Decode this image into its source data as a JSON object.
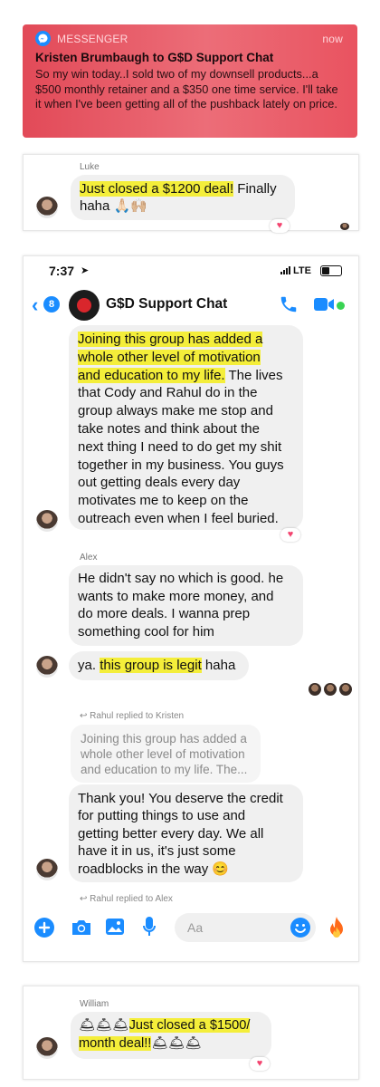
{
  "notification": {
    "app": "MESSENGER",
    "time": "now",
    "title": "Kristen Brumbaugh to G$D Support Chat",
    "body": "So my win today..I sold two of my downsell products...a $500 monthly retainer and a $350 one time service. I'll take it when I've been getting all of the pushback lately on price."
  },
  "card_luke": {
    "sender": "Luke",
    "highlight": "Just closed a $1200 deal!",
    "rest1": " Finally",
    "rest2": "haha 🙏🏻🙌🏼"
  },
  "chat": {
    "status": {
      "time": "7:37",
      "network": "LTE"
    },
    "header": {
      "back_count": "8",
      "title": "G$D Support Chat"
    },
    "msg1": {
      "hl_lines": [
        "Joining this group has added a",
        "whole other level of motivation",
        "and education to my life."
      ],
      "tail_lines": [
        " The lives",
        "that Cody and Rahul do in the",
        "group always make me stop and",
        "take notes and think about the",
        "next thing I need to do get my shit",
        "together in my business.  You guys",
        "out getting deals every day",
        "motivates me to keep on the",
        "outreach even when I feel buried."
      ]
    },
    "alex": {
      "sender": "Alex",
      "msg_lines": [
        "He didn't say no which is good. he",
        "wants to make more money, and",
        "do more deals. I wanna prep",
        "something cool for him"
      ],
      "msg2_pre": "ya. ",
      "msg2_hl": "this group is legit",
      "msg2_post": " haha"
    },
    "reply1": {
      "label": "Rahul replied to Kristen",
      "quote_lines": [
        "Joining this group has added a",
        "whole other level of motivation",
        "and education to my life.  The..."
      ],
      "msg_lines": [
        "Thank you! You deserve the credit",
        "for putting things to use and",
        "getting better every day.  We all",
        "have it in us, it's just some",
        "roadblocks in the way 😊"
      ]
    },
    "reply2": {
      "label": "Rahul replied to Alex"
    },
    "composer": {
      "placeholder": "Aa"
    }
  },
  "card_william": {
    "sender": "William",
    "line1_bells": "🛎🛎🛎",
    "line1_hl": "Just closed a $1500/",
    "line2_hl": "month deal!!",
    "line2_bells": "🛎🛎🛎"
  },
  "colors": {
    "accent": "#1a8cff",
    "highlight": "#f4ee3a",
    "heart": "#f3446f",
    "notification": "#e24a58"
  }
}
